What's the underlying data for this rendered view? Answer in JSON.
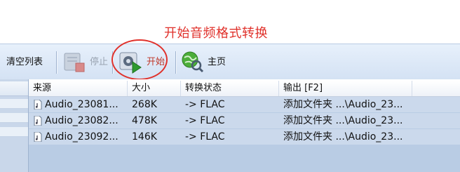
{
  "annotation": {
    "text": "开始音频格式转换",
    "color": "#e0312b"
  },
  "toolbar": {
    "clear_list_label": "清空列表",
    "stop_label": "停止",
    "start_label": "开始",
    "home_label": "主页",
    "icons": {
      "stop": "stop-document-icon",
      "start": "start-play-icon",
      "home": "globe-search-icon"
    }
  },
  "table": {
    "columns": [
      "来源",
      "大小",
      "转换状态",
      "输出 [F2]"
    ],
    "rows": [
      {
        "source": "Audio_23081...",
        "size": "268K",
        "status": "-> FLAC",
        "output": "添加文件夹 ...\\Audio_23..."
      },
      {
        "source": "Audio_23082...",
        "size": "478K",
        "status": "-> FLAC",
        "output": "添加文件夹 ...\\Audio_23..."
      },
      {
        "source": "Audio_23092...",
        "size": "146K",
        "status": "-> FLAC",
        "output": "添加文件夹 ...\\Audio_23..."
      }
    ]
  },
  "colors": {
    "accent_red": "#e0312b",
    "toolbar_bg": "#dbe7f6",
    "row_bg": "#cbd9ec"
  }
}
